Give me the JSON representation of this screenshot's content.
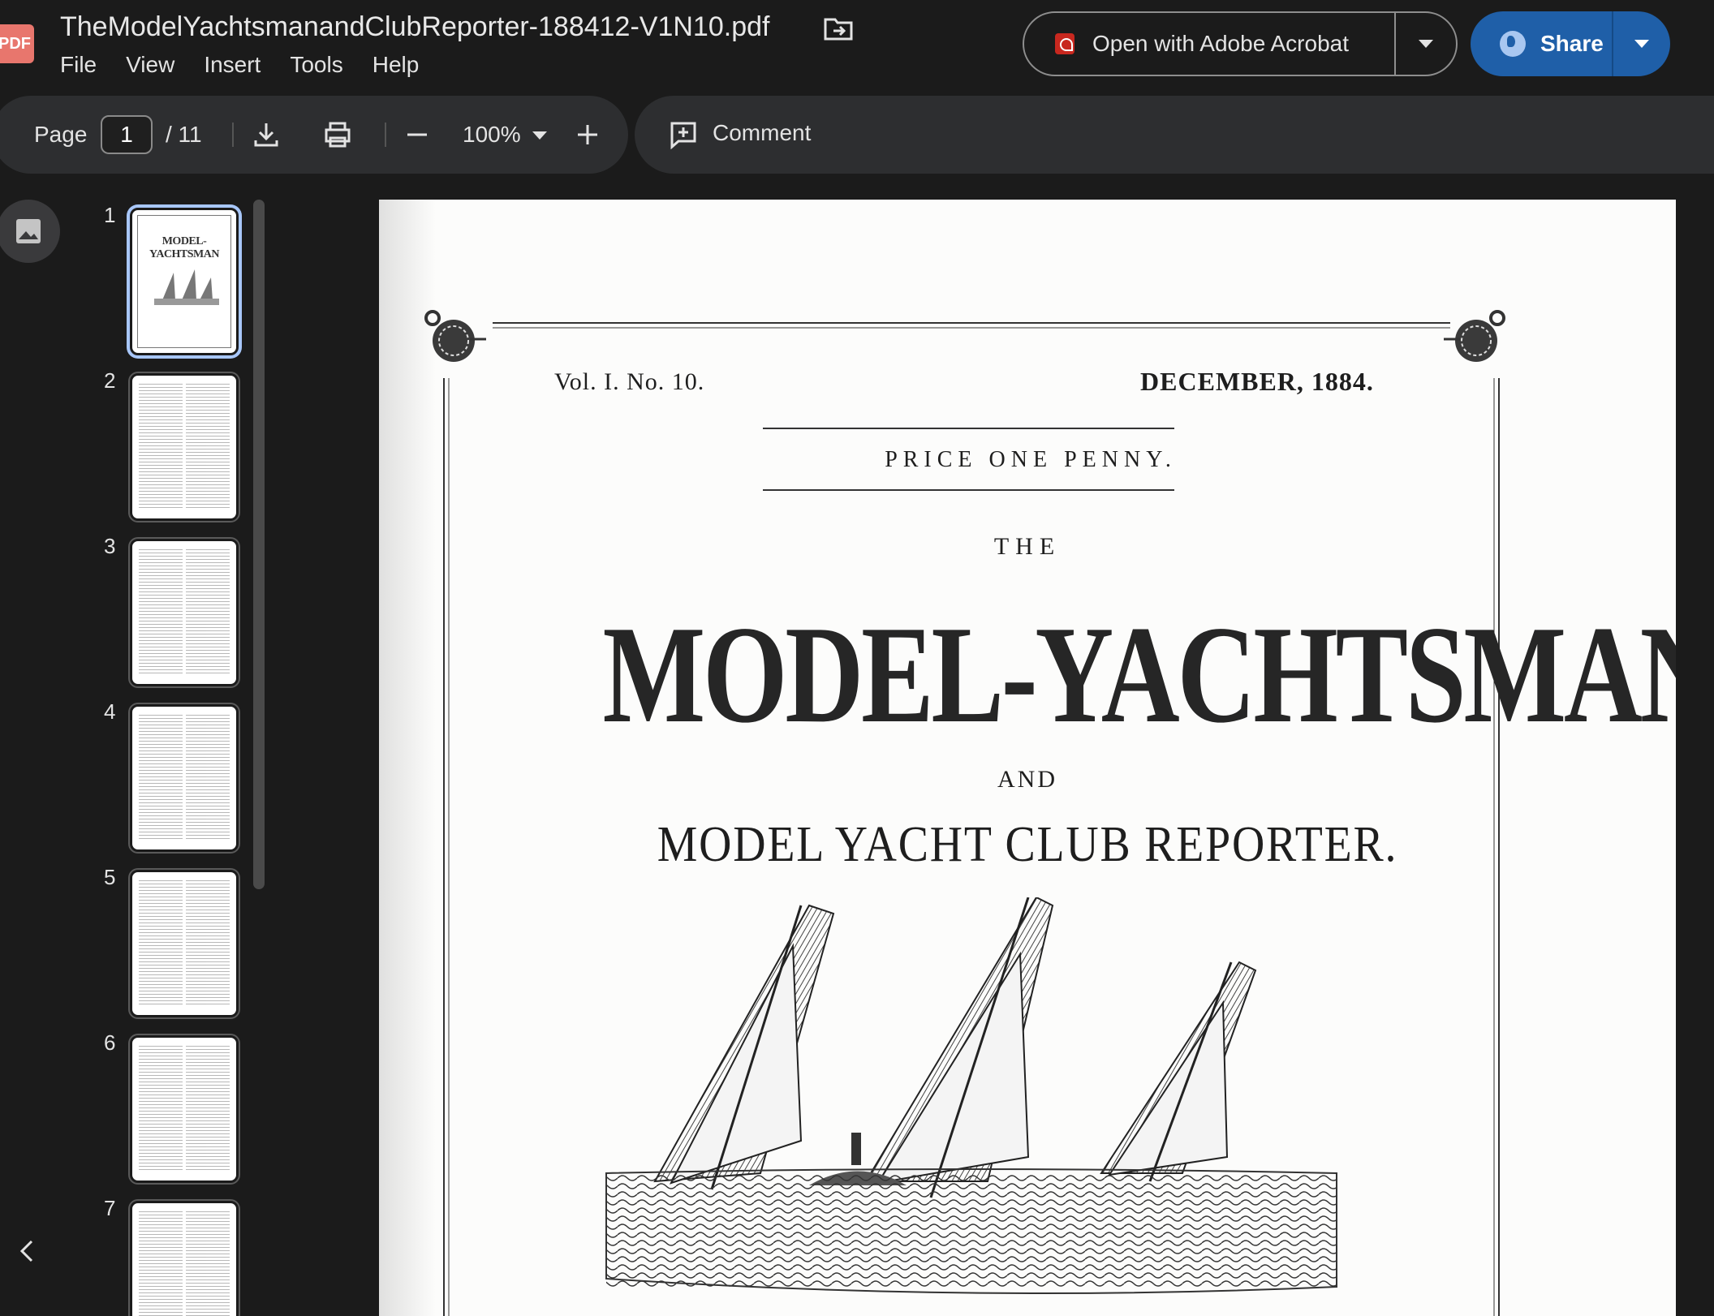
{
  "app": {
    "badge": "PDF",
    "file_title": "TheModelYachtsmanandClubReporter-188412-V1N10.pdf",
    "menu": [
      "File",
      "View",
      "Insert",
      "Tools",
      "Help"
    ],
    "open_with_label": "Open with Adobe Acrobat",
    "share_label": "Share",
    "accent_color": "#1f5fa8"
  },
  "toolbar": {
    "page_label": "Page",
    "current_page": "1",
    "total_pages": "/ 11",
    "zoom": "100%",
    "comment_label": "Comment"
  },
  "thumbnails": {
    "pages": [
      "1",
      "2",
      "3",
      "4",
      "5",
      "6",
      "7"
    ],
    "selected": "1",
    "cover_title": "MODEL-YACHTSMAN"
  },
  "document": {
    "volume": "Vol. I.  No. 10.",
    "date": "DECEMBER, 1884.",
    "price": "PRICE ONE PENNY.",
    "the": "THE",
    "masthead": "MODEL-YACHTSMAN",
    "and": "AND",
    "subtitle": "MODEL YACHT CLUB REPORTER."
  }
}
